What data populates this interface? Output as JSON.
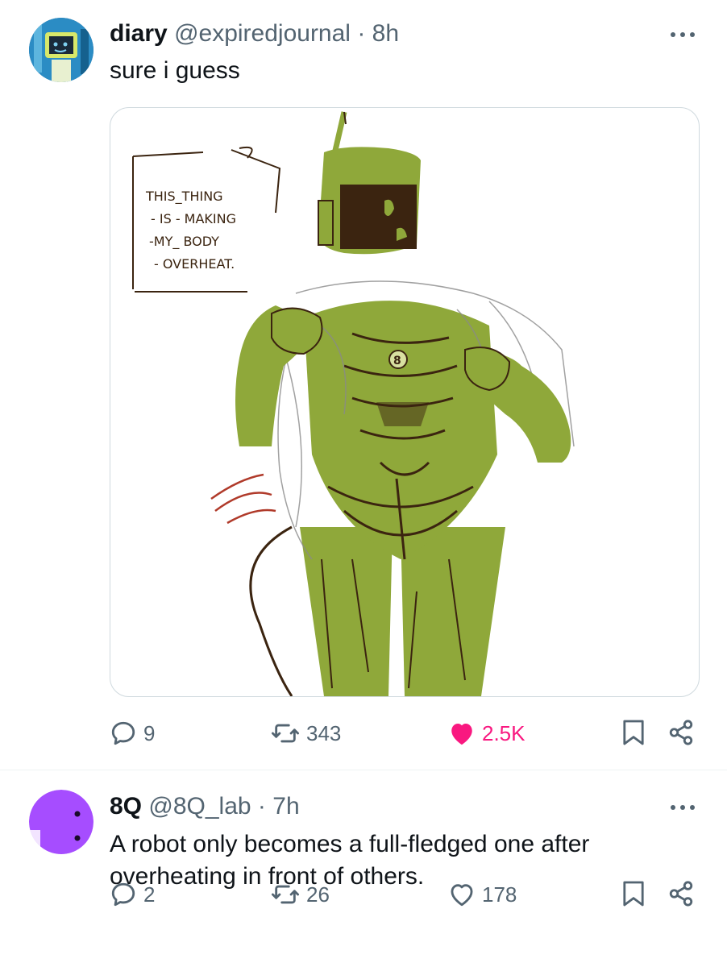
{
  "posts": [
    {
      "author": "diary",
      "handle": "@expiredjournal",
      "separator": "·",
      "time": "8h",
      "text": "sure i guess",
      "image": {
        "caption_lines": [
          "THIS_THING",
          "- IS - MAKING",
          "-MY_ BODY",
          "- OVERHEAT."
        ],
        "chest_badge": "8",
        "colors": {
          "body": "#8fa83a",
          "ink": "#3b2410",
          "accent": "#b03a2a"
        }
      },
      "actions": {
        "replies": "9",
        "reposts": "343",
        "likes": "2.5K",
        "liked": true
      },
      "avatar_color": "#2b8cc4"
    },
    {
      "author": "8Q",
      "handle": "@8Q_lab",
      "separator": "·",
      "time": "7h",
      "text": "A robot only becomes a full-fledged one after overheating in front of others.",
      "actions": {
        "replies": "2",
        "reposts": "26",
        "likes": "178",
        "liked": false
      },
      "avatar_color": "#a64dff"
    }
  ],
  "icons": [
    "more-icon",
    "reply-icon",
    "repost-icon",
    "like-icon",
    "bookmark-icon",
    "share-icon"
  ],
  "colors": {
    "muted": "#536471",
    "like": "#f91880",
    "border": "#cfd9de"
  }
}
